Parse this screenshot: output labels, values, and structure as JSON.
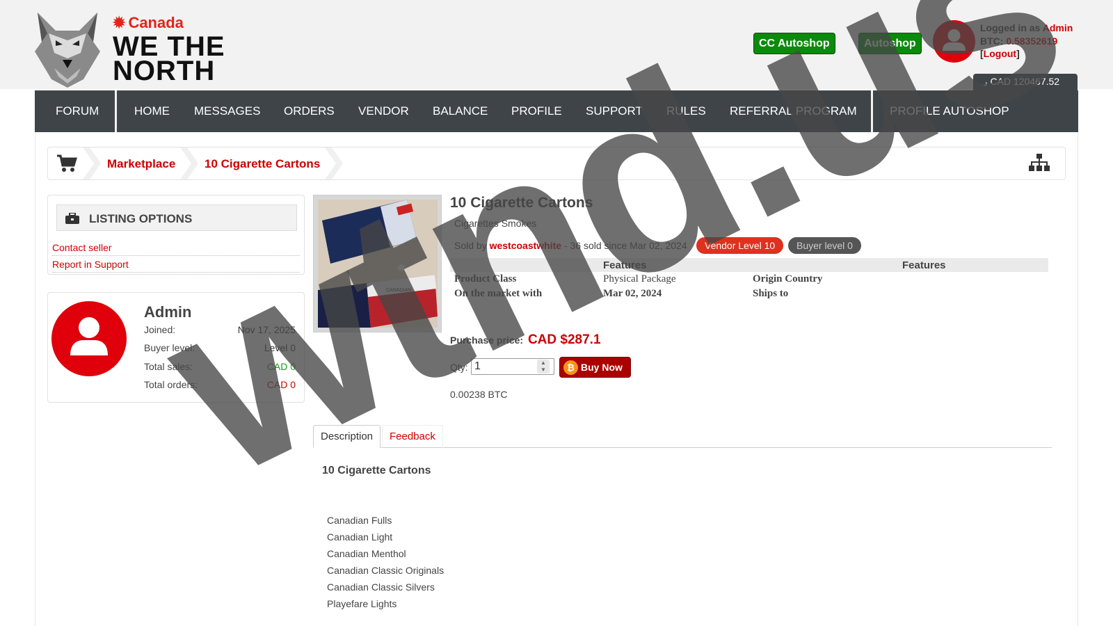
{
  "header": {
    "logo_country": "Canada",
    "logo_line1": "WE THE",
    "logo_line2": "NORTH",
    "cc_autoshop_label": "CC Autoshop",
    "autoshop_label": "Autoshop",
    "logged_in_prefix": "Logged in as",
    "username": "Admin",
    "btc_label": "BTC:",
    "btc_balance": "0.58352619",
    "logout_label": "Logout",
    "cad_balance": "CAD 120467.52"
  },
  "nav": {
    "items": [
      "FORUM",
      "HOME",
      "MESSAGES",
      "ORDERS",
      "VENDOR",
      "BALANCE",
      "PROFILE",
      "SUPPORT",
      "RULES",
      "REFERRAL PROGRAM",
      "PROFILE AUTOSHOP"
    ]
  },
  "breadcrumb": {
    "items": [
      "Marketplace",
      "10 Cigarette Cartons"
    ]
  },
  "listing_options": {
    "title": "LISTING OPTIONS",
    "links": [
      "Contact seller",
      "Report in Support"
    ]
  },
  "seller_card": {
    "name": "Admin",
    "rows": [
      {
        "label": "Joined:",
        "value": "Nov 17, 2025",
        "color": "#333333"
      },
      {
        "label": "Buyer level:",
        "value": "Level 0",
        "color": "#333333"
      },
      {
        "label": "Total sales:",
        "value": "CAD 0",
        "color": "#1a9c1a"
      },
      {
        "label": "Total orders:",
        "value": "CAD 0",
        "color": "#cc0000"
      }
    ]
  },
  "product": {
    "title": "10 Cigarette Cartons",
    "subtitle": "Cigarettes Smokes",
    "sold_by": "Sold by",
    "vendor": "westcoastwhite",
    "sold_info": "- 36 sold since Mar 02, 2024",
    "vendor_level": "Vendor Level 10",
    "buyer_level": "Buyer level 0",
    "features_header_1": "Features",
    "features_header_2": "Features",
    "features": [
      {
        "label": "Product Class",
        "value": "Physical Package"
      },
      {
        "label": "On the market with",
        "value": "Mar 02, 2024"
      }
    ],
    "features_right": [
      {
        "label": "Origin Country",
        "value": ""
      },
      {
        "label": "Ships to",
        "value": ""
      }
    ],
    "price_label": "Purchase price:",
    "price": "CAD $287.1",
    "qty_label": "Qty:",
    "qty_value": "1",
    "buy_label": "Buy Now",
    "btc_price": "0.00238 BTC",
    "image_text": "CANADIAN"
  },
  "tabs": {
    "description": "Description",
    "feedback": "Feedback"
  },
  "description": {
    "title": "10 Cigarette Cartons",
    "items": [
      "Canadian Fulls",
      "Canadian Light",
      "Canadian Menthol",
      "Canadian Classic Originals",
      "Canadian Classic Silvers",
      "Playefare Lights"
    ]
  },
  "watermark": "wtnd.us",
  "colors": {
    "accent_red": "#cc0000",
    "nav_bg": "#3f4449",
    "green_button": "#0b8a0b"
  }
}
